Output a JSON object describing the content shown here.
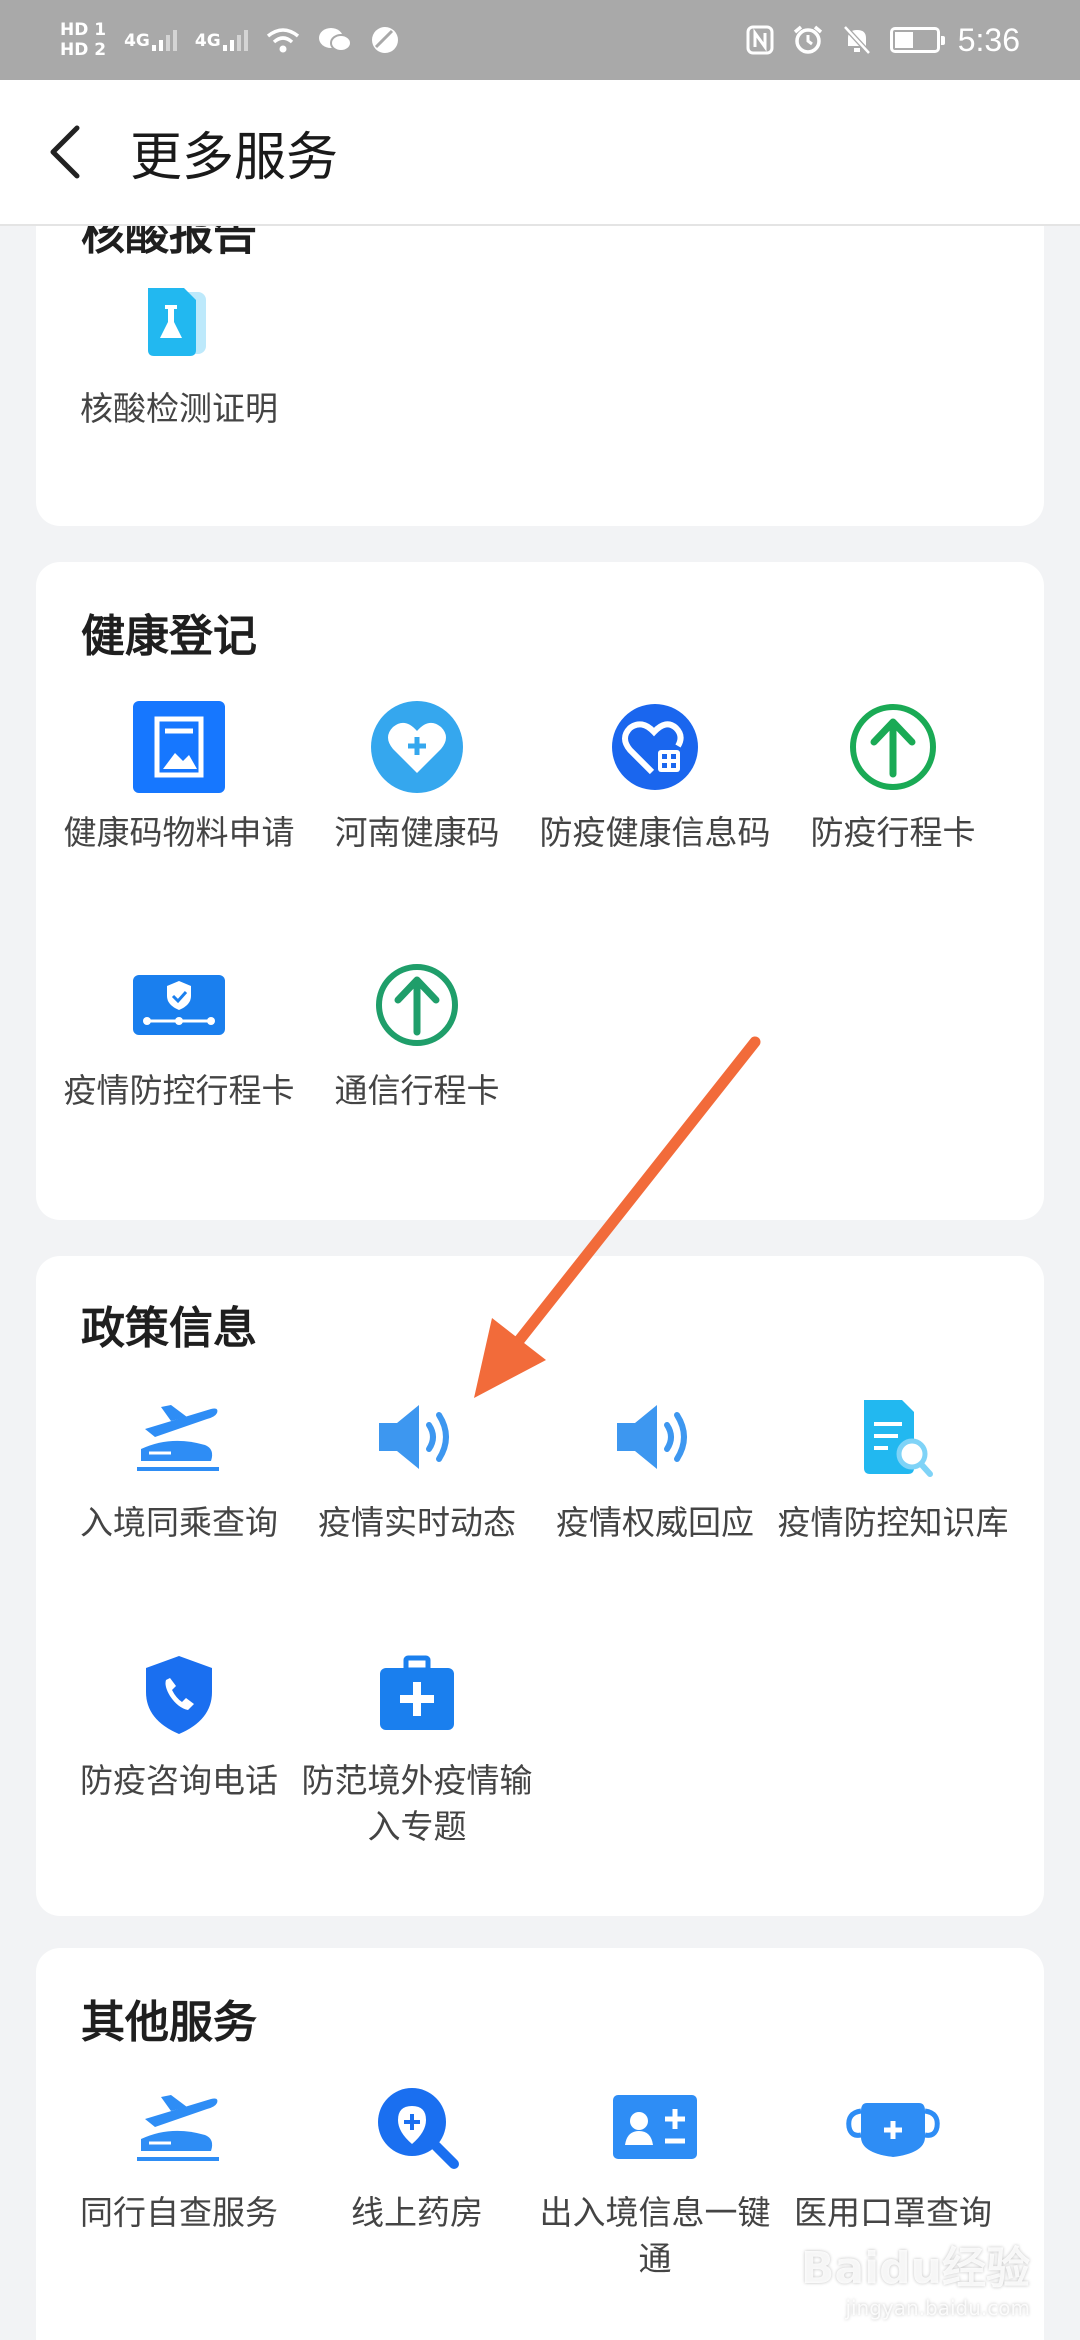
{
  "status_bar": {
    "hd1": "HD 1",
    "hd2": "HD 2",
    "net1": "4G",
    "net2": "4G",
    "time": "5:36",
    "battery_level": 0.45
  },
  "header": {
    "title": "更多服务"
  },
  "sections": {
    "nucleic": {
      "title": "核酸报告",
      "items": [
        {
          "label": "核酸检测证明",
          "icon": "test-tube-doc-icon"
        }
      ]
    },
    "health": {
      "title": "健康登记",
      "items": [
        {
          "label": "健康码物料申请",
          "icon": "picture-doc-icon"
        },
        {
          "label": "河南健康码",
          "icon": "heart-plus-icon"
        },
        {
          "label": "防疫健康信息码",
          "icon": "heart-qr-icon"
        },
        {
          "label": "防疫行程卡",
          "icon": "up-arrow-circle-icon"
        },
        {
          "label": "疫情防控行程卡",
          "icon": "shield-route-card-icon"
        },
        {
          "label": "通信行程卡",
          "icon": "up-arrow-circle-icon"
        }
      ]
    },
    "policy": {
      "title": "政策信息",
      "items": [
        {
          "label": "入境同乘查询",
          "icon": "plane-train-icon"
        },
        {
          "label": "疫情实时动态",
          "icon": "speaker-icon"
        },
        {
          "label": "疫情权威回应",
          "icon": "speaker-icon"
        },
        {
          "label": "疫情防控知识库",
          "icon": "doc-search-icon"
        },
        {
          "label": "防疫咨询电话",
          "icon": "shield-phone-icon"
        },
        {
          "label": "防范境外疫情输入专题",
          "icon": "medical-kit-icon"
        }
      ]
    },
    "other": {
      "title": "其他服务",
      "items": [
        {
          "label": "同行自查服务",
          "icon": "plane-train-icon"
        },
        {
          "label": "线上药房",
          "icon": "pharmacy-search-icon"
        },
        {
          "label": "出入境信息一键通",
          "icon": "id-card-icon"
        },
        {
          "label": "医用口罩查询",
          "icon": "mask-icon"
        }
      ]
    }
  },
  "watermark": {
    "brand": "Baidu经验",
    "url": "jingyan.baidu.com"
  },
  "colors": {
    "accent_blue": "#1677ff",
    "green": "#1aaa55",
    "arrow": "#f26b3a",
    "card_bg": "#ffffff",
    "page_bg": "#f2f3f5"
  }
}
